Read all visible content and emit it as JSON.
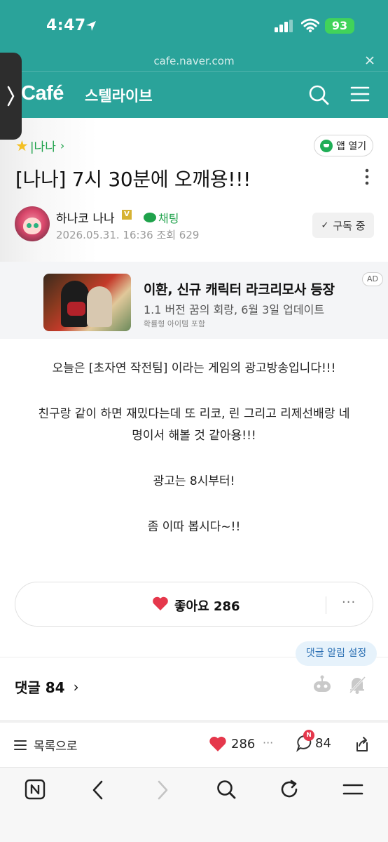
{
  "status_bar": {
    "time": "4:47",
    "battery": "93"
  },
  "browser": {
    "url": "cafe.naver.com"
  },
  "cafe_nav": {
    "logo": "Café",
    "cafe_name": "스텔라이브"
  },
  "post": {
    "board": "|나나",
    "app_open": "앱 열기",
    "title": "[나나] 7시 30분에 오깨용!!!",
    "author": "하나코 나나",
    "verified": "V",
    "chat_label": "채팅",
    "date": "2026.05.31. 16:36",
    "views": "조회 629",
    "subscribe_label": "구독 중"
  },
  "ad": {
    "title": "이환, 신규 캐릭터 라크리모사 등장",
    "subtitle": "1.1 버전 꿈의 회랑, 6월 3일 업데이트",
    "note": "확률형 아이템 포함",
    "badge": "AD"
  },
  "body": {
    "p1": "오늘은 [초자연 작전팀] 이라는 게임의 광고방송입니다!!!",
    "p2_line1": "친구랑 같이 하면 재밌다는데 또 리코, 린 그리고 리제선배랑 네",
    "p2_line2": "명이서 해볼 것 같아용!!!",
    "p3": "광고는 8시부터!",
    "p4": "좀 이따 봅시다~!!"
  },
  "like": {
    "label": "좋아요 286",
    "more": "···"
  },
  "comments": {
    "alarm_label": "댓글 알림 설정",
    "header": "댓글 84"
  },
  "action_bar": {
    "list_label": "목록으로",
    "like_count": "286",
    "more": "···",
    "comment_count": "84",
    "new_badge": "N"
  },
  "colors": {
    "header_teal": "#2aa39a",
    "naver_green": "#1fa24b",
    "like_red": "#e5384c"
  }
}
